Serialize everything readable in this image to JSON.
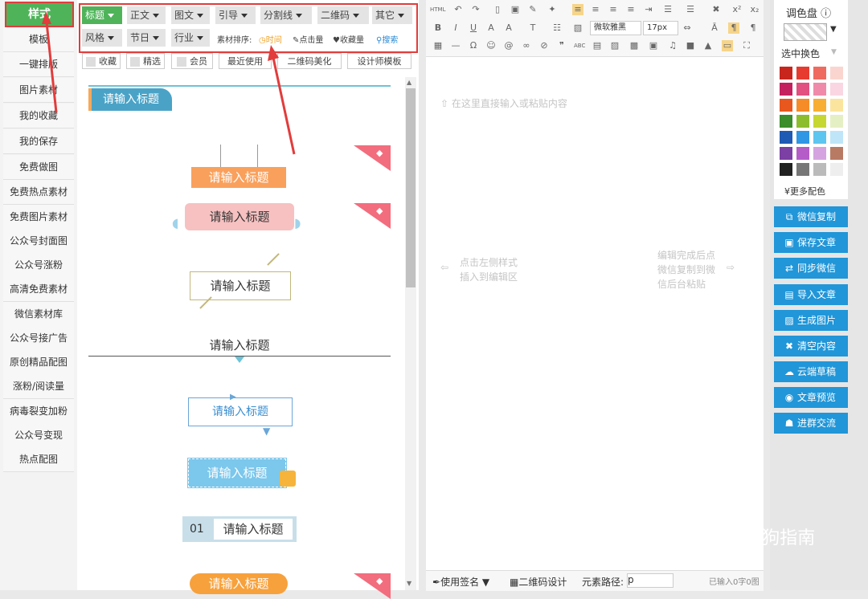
{
  "sidebar": {
    "items": [
      "样式",
      "模板",
      "一键排版",
      "图片素材",
      "我的收藏",
      "我的保存",
      "免费做图",
      "免费热点素材",
      "免费图片素材",
      "公众号封面图",
      "公众号涨粉",
      "高清免费素材",
      "微信素材库",
      "公众号接广告",
      "原创精品配图",
      "涨粉/阅读量",
      "病毒裂变加粉",
      "公众号变现",
      "热点配图"
    ]
  },
  "filters": {
    "row1": [
      "标题",
      "正文",
      "图文",
      "引导",
      "分割线",
      "二维码",
      "其它"
    ],
    "row2": [
      "风格",
      "节日",
      "行业"
    ],
    "sort_label": "素材排序:",
    "sort_time": "时间",
    "sort_clicks": "点击量",
    "sort_favorites": "收藏量",
    "search": "搜索"
  },
  "subbar": {
    "favorite": "收藏",
    "featured": "精选",
    "member": "会员",
    "recent": "最近使用",
    "qrcode": "二维码美化",
    "designer": "设计师模板"
  },
  "templates": {
    "title": "请输入标题",
    "numbered_prefix": "01"
  },
  "editor": {
    "font": "微软雅黑",
    "size": "17px",
    "html": "HTML",
    "placeholder_hint": "在这里直接输入或粘贴内容",
    "left_hint_1": "点击左侧样式",
    "left_hint_2": "插入到编辑区",
    "right_hint_1": "编辑完成后点",
    "right_hint_2": "微信复制到微",
    "right_hint_3": "信后台粘贴",
    "status_signature": "使用签名",
    "status_qrcode": "二维码设计",
    "status_path": "元素路径:",
    "status_path_value": "p",
    "status_count": "已输入0字0图"
  },
  "palette": {
    "title": "调色盘",
    "selected_label": "选中换色",
    "more": "更多配色",
    "colors": [
      "#c8261d",
      "#e73b2f",
      "#ef6b5f",
      "#fad5d0",
      "#c41f5f",
      "#e24f81",
      "#f08aab",
      "#fad6e2",
      "#e8571d",
      "#f58c28",
      "#f8ae33",
      "#fbe59e",
      "#3b8c2a",
      "#8cbd2f",
      "#c7d732",
      "#e5efc4",
      "#1f5ab4",
      "#2f97e3",
      "#5dc6f0",
      "#bfe6f8",
      "#7c3fa3",
      "#b55cc9",
      "#d5a4e0",
      "#b97a63",
      "#222222",
      "#777777",
      "#bbbbbb",
      "#eeeeee"
    ]
  },
  "actions": [
    "微信复制",
    "保存文章",
    "同步微信",
    "导入文章",
    "生成图片",
    "清空内容",
    "云端草稿",
    "文章预览",
    "进群交流"
  ],
  "watermark": "搜狗指南"
}
